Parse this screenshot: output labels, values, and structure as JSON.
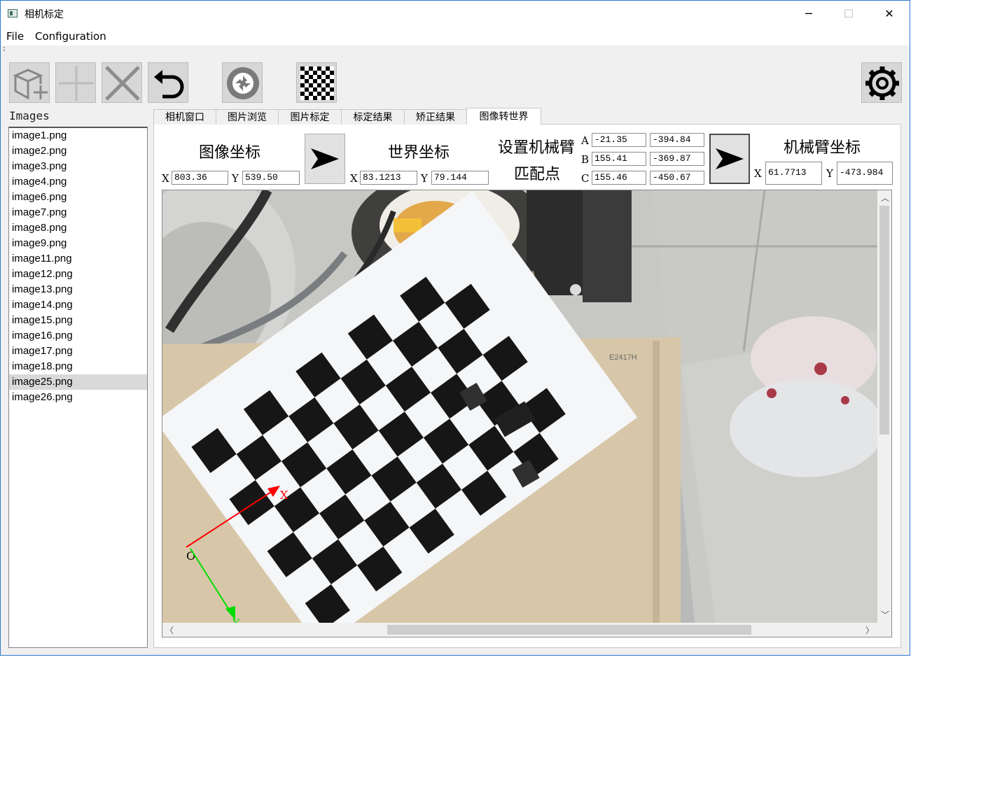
{
  "window": {
    "title": "相机标定",
    "minimize": "─",
    "maximize": "☐",
    "close": "✕"
  },
  "menu": {
    "file": "File",
    "configuration": "Configuration"
  },
  "toolbar": {
    "icons": [
      "add-box-icon",
      "add-icon",
      "delete-icon",
      "undo-icon",
      "camera-shutter-icon",
      "checkerboard-icon",
      "settings-gear-icon"
    ]
  },
  "sidebar": {
    "label": "Images",
    "items": [
      "image1.png",
      "image2.png",
      "image3.png",
      "image4.png",
      "image6.png",
      "image7.png",
      "image8.png",
      "image9.png",
      "image11.png",
      "image12.png",
      "image13.png",
      "image14.png",
      "image15.png",
      "image16.png",
      "image17.png",
      "image18.png",
      "image25.png",
      "image26.png"
    ],
    "selected": "image25.png"
  },
  "tabs": [
    "相机窗口",
    "图片浏览",
    "图片标定",
    "标定结果",
    "矫正结果",
    "图像转世界"
  ],
  "active_tab": "图像转世界",
  "image_coord": {
    "heading": "图像坐标",
    "x_label": "X",
    "x": "803.36",
    "y_label": "Y",
    "y": "539.50"
  },
  "world_coord": {
    "heading": "世界坐标",
    "x_label": "X",
    "x": "83.1213",
    "y_label": "Y",
    "y": "79.144"
  },
  "match_points": {
    "heading_line1": "设置机械臂",
    "heading_line2": "匹配点",
    "rows": [
      {
        "label": "A",
        "x": "-21.35",
        "y": "-394.84"
      },
      {
        "label": "B",
        "x": "155.41",
        "y": "-369.87"
      },
      {
        "label": "C",
        "x": "155.46",
        "y": "-450.67"
      }
    ]
  },
  "arm_coord": {
    "heading": "机械臂坐标",
    "x_label": "X",
    "x": "61.7713",
    "y_label": "Y",
    "y": "-473.984"
  },
  "image_view": {
    "box_label": "E2417H",
    "axis_x": "X",
    "axis_origin": "O",
    "axis_y": "Y"
  }
}
